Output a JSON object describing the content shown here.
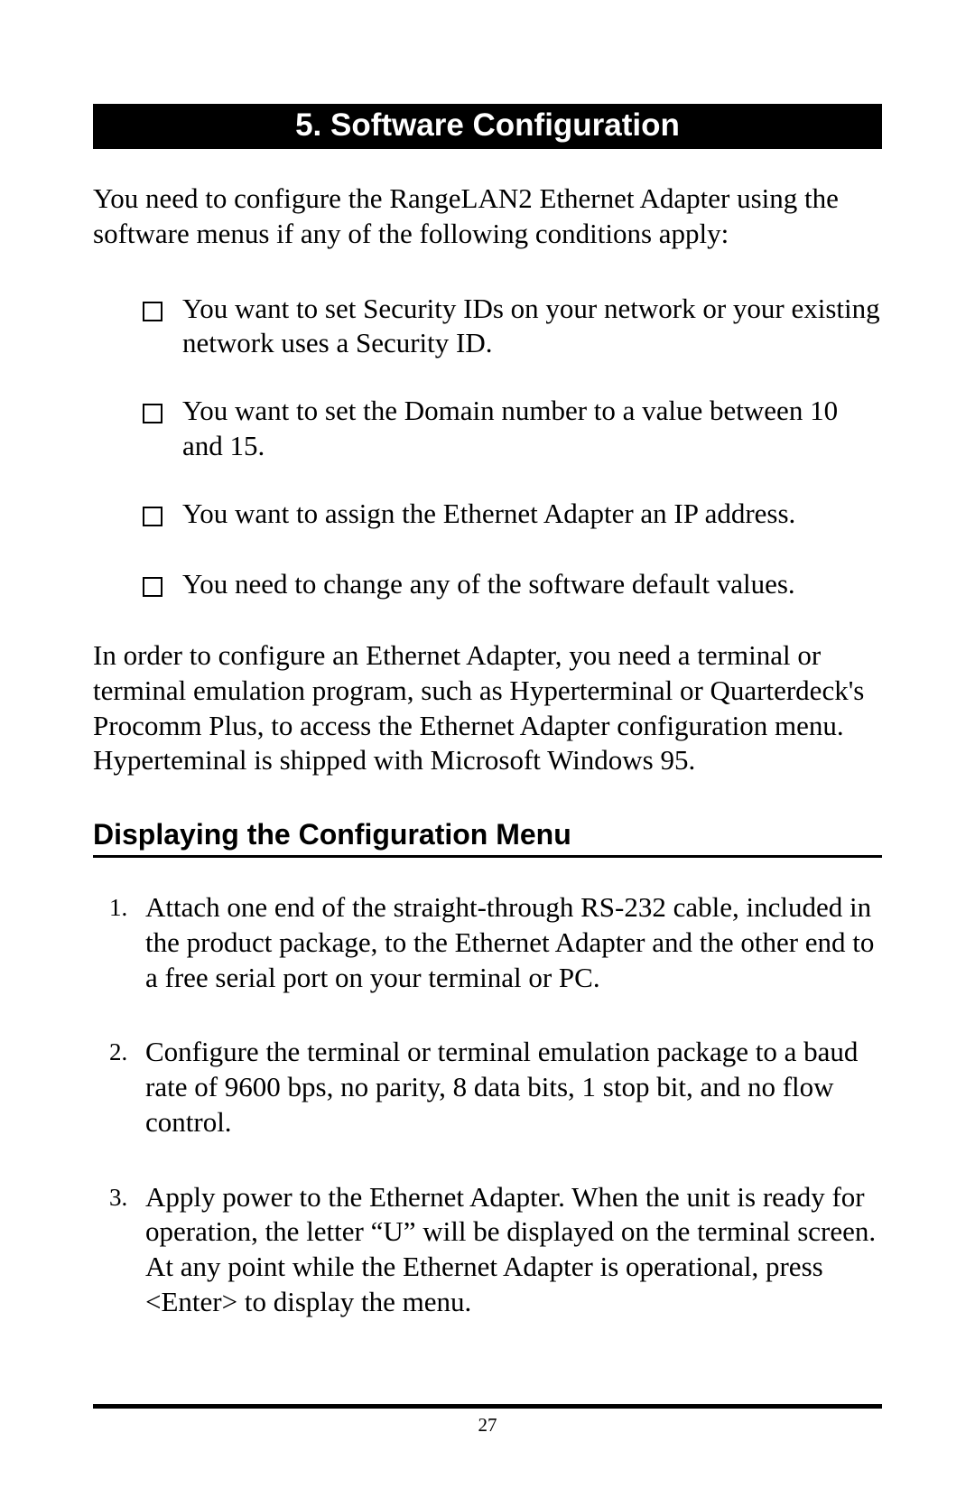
{
  "chapter": {
    "title": "5. Software Configuration"
  },
  "intro": "You need to configure the RangeLAN2 Ethernet Adapter using the software menus if any of the following conditions apply:",
  "checkboxes": [
    "You want to set Security IDs on your network or your existing network uses a Security ID.",
    "You want to set the Domain number to a value between 10 and 15.",
    "You want to assign the Ethernet Adapter an IP address.",
    "You need to change any of the software default values."
  ],
  "middle": "In order to configure an Ethernet Adapter, you need a terminal or terminal emulation program, such as Hyperterminal or Quarterdeck's Procomm Plus, to access the Ethernet Adapter configuration menu.  Hyperteminal is shipped with Microsoft Windows 95.",
  "section": {
    "title": "Displaying the Configuration Menu"
  },
  "steps": [
    {
      "num": "1.",
      "text": "Attach one end of the straight-through RS-232 cable, included in the product package, to the Ethernet Adapter and the other end to a free serial port on your terminal or PC."
    },
    {
      "num": "2.",
      "text": "Configure the terminal or terminal emulation package to a baud rate of 9600 bps, no parity, 8 data bits, 1 stop bit, and no flow control."
    },
    {
      "num": "3.",
      "text": "Apply power to the Ethernet Adapter.  When the unit is ready for operation, the letter “U” will be displayed on the terminal screen.  At any point while the Ethernet Adapter is operational,  press <Enter> to display the menu."
    }
  ],
  "pageNumber": "27"
}
